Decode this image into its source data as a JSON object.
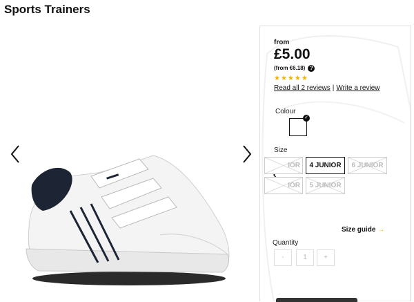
{
  "page": {
    "title": "Sports Trainers"
  },
  "product": {
    "from_label": "from",
    "price": "£5.00",
    "alt_price": "(from €6.18)",
    "help_icon_glyph": "?",
    "rating_stars": "★★★★★",
    "rating_value": 5,
    "rating_max": 5,
    "rating_color": "#f0b400",
    "reviews_link": "Read all 2 reviews",
    "reviews_separator": "|",
    "write_review_link": "Write a review"
  },
  "options": {
    "colour_label": "Colour",
    "colour_check_glyph": "✓",
    "size_label": "Size",
    "sizes": [
      {
        "label": "IOR",
        "available": false
      },
      {
        "label": "4 JUNIOR",
        "available": true,
        "selected": true
      },
      {
        "label": "6 JUNIOR",
        "available": false
      },
      {
        "label": "IOR",
        "available": false
      },
      {
        "label": "5 JUNIOR",
        "available": false
      }
    ],
    "size_guide_label": "Size guide",
    "size_guide_arrow": "→",
    "quantity_label": "Quantity",
    "qty_minus": "-",
    "qty_value": "1",
    "qty_plus": "+"
  },
  "icons": {
    "gallery_prev": "chevron-left-icon",
    "gallery_next": "chevron-right-icon",
    "size_prev": "chevron-left-icon"
  }
}
